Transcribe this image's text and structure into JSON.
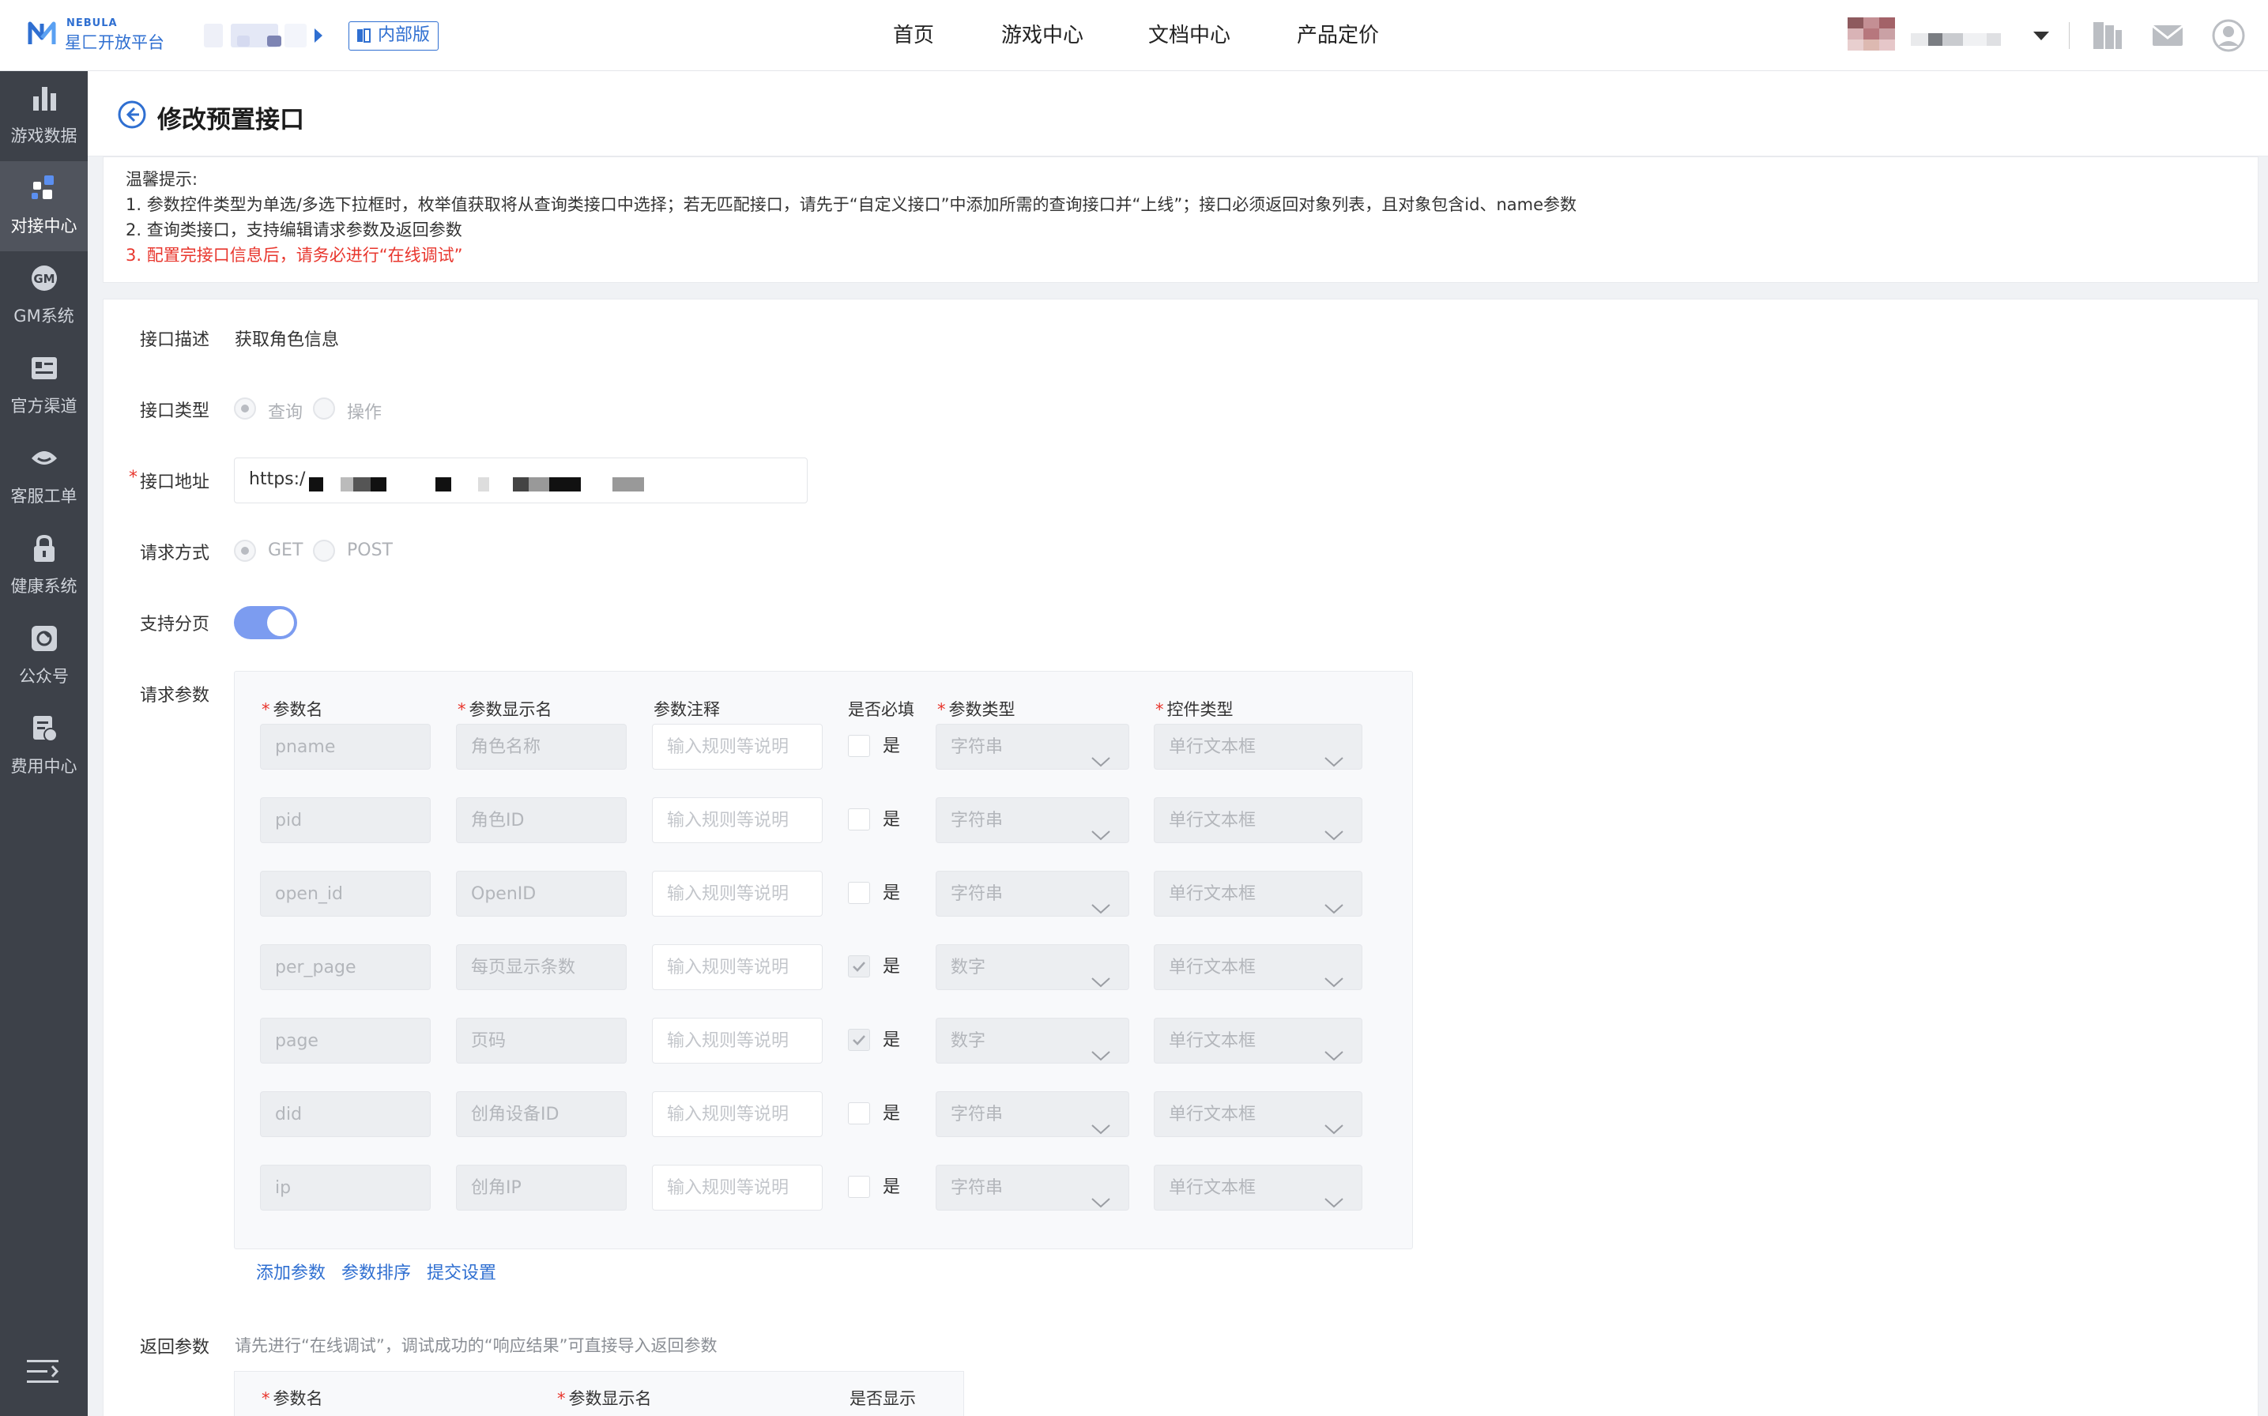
{
  "brand": {
    "name_en": "NEBULA",
    "name_cn": "星匚开放平台",
    "primary_color": "#2f6fd1"
  },
  "header": {
    "internal_label": "内部版",
    "nav": [
      "首页",
      "游戏中心",
      "文档中心",
      "产品定价"
    ],
    "icons": [
      "doc-icon",
      "mail-icon",
      "user-icon"
    ]
  },
  "sidebar": {
    "items": [
      {
        "label": "游戏数据",
        "icon": "bar-chart-icon",
        "active": false
      },
      {
        "label": "对接中心",
        "icon": "connect-icon",
        "active": true
      },
      {
        "label": "GM系统",
        "icon": "gm-icon",
        "active": false
      },
      {
        "label": "官方渠道",
        "icon": "card-icon",
        "active": false
      },
      {
        "label": "客服工单",
        "icon": "headset-icon",
        "active": false
      },
      {
        "label": "健康系统",
        "icon": "lock-icon",
        "active": false
      },
      {
        "label": "公众号",
        "icon": "wechat-icon",
        "active": false
      },
      {
        "label": "费用中心",
        "icon": "bill-icon",
        "active": false
      }
    ],
    "collapse_icon": "menu-collapse-icon"
  },
  "page": {
    "title": "修改预置接口"
  },
  "tips": {
    "title": "温馨提示:",
    "lines": [
      "1. 参数控件类型为单选/多选下拉框时，枚举值获取将从查询类接口中选择；若无匹配接口，请先于“自定义接口”中添加所需的查询接口并“上线”；接口必须返回对象列表，且对象包含id、name参数",
      "2. 查询类接口，支持编辑请求参数及返回参数",
      "3. 配置完接口信息后，请务必进行“在线调试”"
    ]
  },
  "form": {
    "desc_label": "接口描述",
    "desc_value": "获取角色信息",
    "type_label": "接口类型",
    "type_options": [
      "查询",
      "操作"
    ],
    "type_selected": "查询",
    "url_label": "接口地址",
    "url_prefix": "https:/",
    "method_label": "请求方式",
    "method_options": [
      "GET",
      "POST"
    ],
    "method_selected": "GET",
    "paging_label": "支持分页",
    "paging_on": true,
    "req_label": "请求参数",
    "req_columns": [
      "参数名",
      "参数显示名",
      "参数注释",
      "是否必填",
      "参数类型",
      "控件类型"
    ],
    "note_placeholder": "输入规则等说明",
    "required_label": "是",
    "rows": [
      {
        "name": "pname",
        "display": "角色名称",
        "required": false,
        "type": "字符串",
        "control": "单行文本框"
      },
      {
        "name": "pid",
        "display": "角色ID",
        "required": false,
        "type": "字符串",
        "control": "单行文本框"
      },
      {
        "name": "open_id",
        "display": "OpenID",
        "required": false,
        "type": "字符串",
        "control": "单行文本框"
      },
      {
        "name": "per_page",
        "display": "每页显示条数",
        "required": true,
        "type": "数字",
        "control": "单行文本框"
      },
      {
        "name": "page",
        "display": "页码",
        "required": true,
        "type": "数字",
        "control": "单行文本框"
      },
      {
        "name": "did",
        "display": "创角设备ID",
        "required": false,
        "type": "字符串",
        "control": "单行文本框"
      },
      {
        "name": "ip",
        "display": "创角IP",
        "required": false,
        "type": "字符串",
        "control": "单行文本框"
      }
    ],
    "actions": [
      "添加参数",
      "参数排序",
      "提交设置"
    ],
    "resp_label": "返回参数",
    "resp_hint": "请先进行“在线调试”，调试成功的“响应结果”可直接导入返回参数",
    "resp_columns": [
      "参数名",
      "参数显示名",
      "是否显示"
    ]
  }
}
